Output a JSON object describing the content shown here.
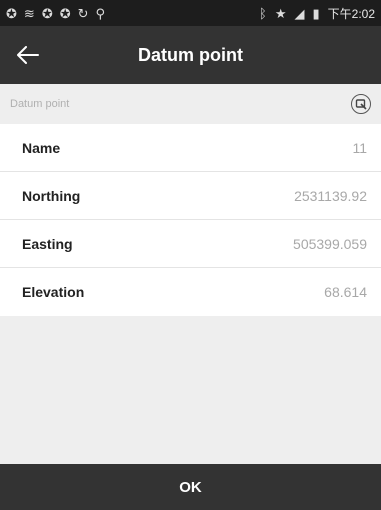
{
  "status_bar": {
    "time": "下午2:02",
    "left_icons": [
      "sync-icon",
      "wifi-icon",
      "sync-icon",
      "sync-icon",
      "refresh-icon",
      "location-icon"
    ],
    "right_icons": [
      "bluetooth-icon",
      "star-icon",
      "signal-icon",
      "battery-icon"
    ]
  },
  "app_bar": {
    "title": "Datum point"
  },
  "section": {
    "label": "Datum point"
  },
  "fields": [
    {
      "label": "Name",
      "value": "11"
    },
    {
      "label": "Northing",
      "value": "2531139.92"
    },
    {
      "label": "Easting",
      "value": "505399.059"
    },
    {
      "label": "Elevation",
      "value": "68.614"
    }
  ],
  "footer": {
    "ok_label": "OK"
  }
}
